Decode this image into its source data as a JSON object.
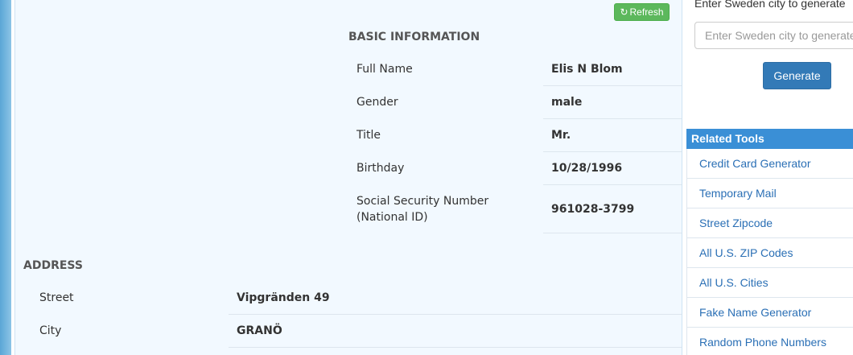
{
  "refresh_button": {
    "icon": "refresh-icon",
    "label": "Refresh"
  },
  "basic_info": {
    "title": "BASIC INFORMATION",
    "rows": [
      {
        "label": "Full Name",
        "value": "Elis N Blom"
      },
      {
        "label": "Gender",
        "value": "male"
      },
      {
        "label": "Title",
        "value": "Mr."
      },
      {
        "label": "Birthday",
        "value": "10/28/1996"
      },
      {
        "label": "Social Security Number",
        "label2": "(National ID)",
        "value": "961028-3799"
      }
    ]
  },
  "address": {
    "title": "ADDRESS",
    "rows": [
      {
        "label": "Street",
        "value": "Vipgränden 49"
      },
      {
        "label": "City",
        "value": "GRANÖ"
      }
    ]
  },
  "generator": {
    "label": "Enter Sweden city to generate",
    "placeholder": "Enter Sweden city to generate",
    "button_label": "Generate"
  },
  "related_tools": {
    "title": "Related Tools",
    "items": [
      "Credit Card Generator",
      "Temporary Mail",
      "Street Zipcode",
      "All U.S. ZIP Codes",
      "All U.S. Cities",
      "Fake Name Generator",
      "Random Phone Numbers"
    ]
  }
}
